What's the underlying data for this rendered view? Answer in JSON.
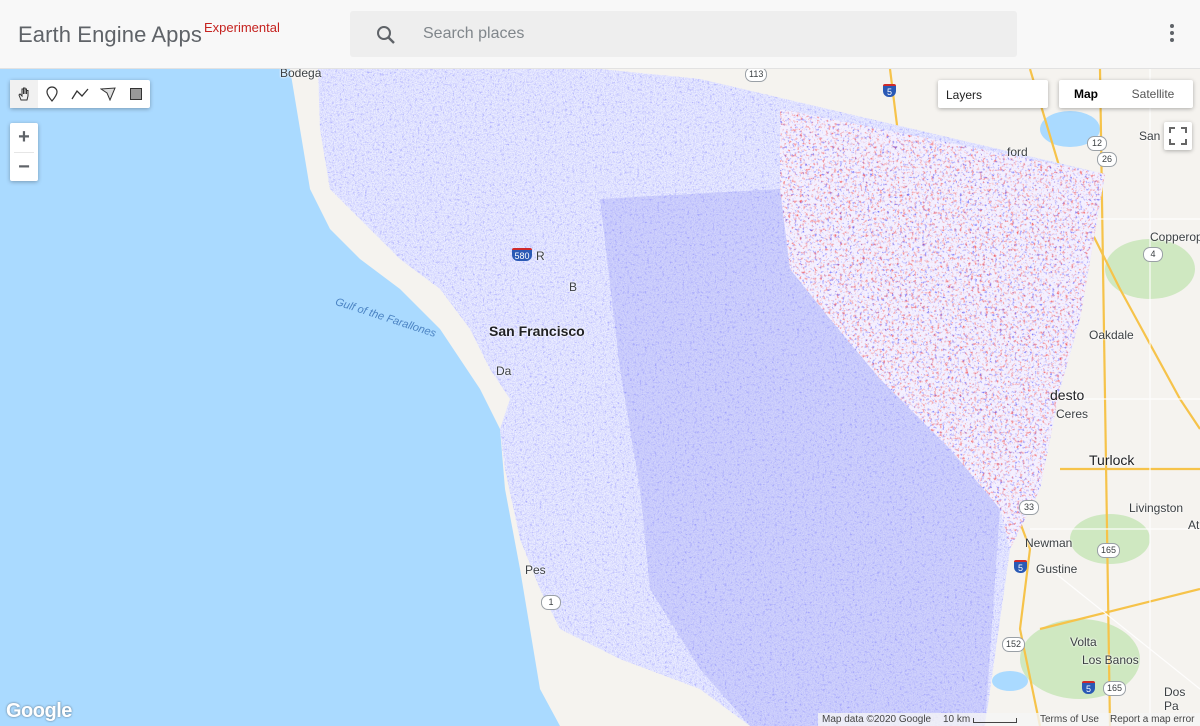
{
  "header": {
    "title": "Earth Engine Apps",
    "badge": "Experimental",
    "search_placeholder": "Search places",
    "menu_icon": "more-vert-icon"
  },
  "tools": {
    "items": [
      {
        "name": "hand-icon",
        "label": "Pan"
      },
      {
        "name": "marker-icon",
        "label": "Point"
      },
      {
        "name": "line-icon",
        "label": "Line"
      },
      {
        "name": "polygon-icon",
        "label": "Polygon"
      },
      {
        "name": "rectangle-icon",
        "label": "Rectangle"
      }
    ]
  },
  "zoom": {
    "in": "+",
    "out": "−"
  },
  "layers": {
    "label": "Layers"
  },
  "map_type": {
    "map": "Map",
    "satellite": "Satellite",
    "selected": "Map"
  },
  "map_labels": {
    "bodega": "Bodega",
    "gulf": "Gulf of the Farallones",
    "san_francisco": "San Francisco",
    "daly": "Da",
    "pes": "Pes",
    "b": "B",
    "r": "R",
    "ford": "ford",
    "san": "San",
    "copperop": "Copperop",
    "oakdale": "Oakdale",
    "modesto": "desto",
    "ceres": "Ceres",
    "turlock": "Turlock",
    "livingston": "Livingston",
    "newman": "Newman",
    "gustine": "Gustine",
    "volta": "Volta",
    "los_banos": "Los Banos",
    "dos_palos": "Dos Pa",
    "atwater": "At"
  },
  "shields": {
    "r113": "113",
    "r5a": "5",
    "r12": "12",
    "r26": "26",
    "r4": "4",
    "r580": "580",
    "r33": "33",
    "r165a": "165",
    "r5b": "5",
    "r152": "152",
    "r5c": "5",
    "r165b": "165",
    "r1": "1"
  },
  "footer": {
    "map_data": "Map data ©2020 Google",
    "scale": "10 km",
    "terms": "Terms of Use",
    "report": "Report a map error"
  },
  "brand": {
    "logo": "Google"
  },
  "colors": {
    "water": "#aadaff",
    "land": "#f5f3ef",
    "high": "#e8000d",
    "low": "#1a1aff",
    "badge": "#c5221f"
  }
}
